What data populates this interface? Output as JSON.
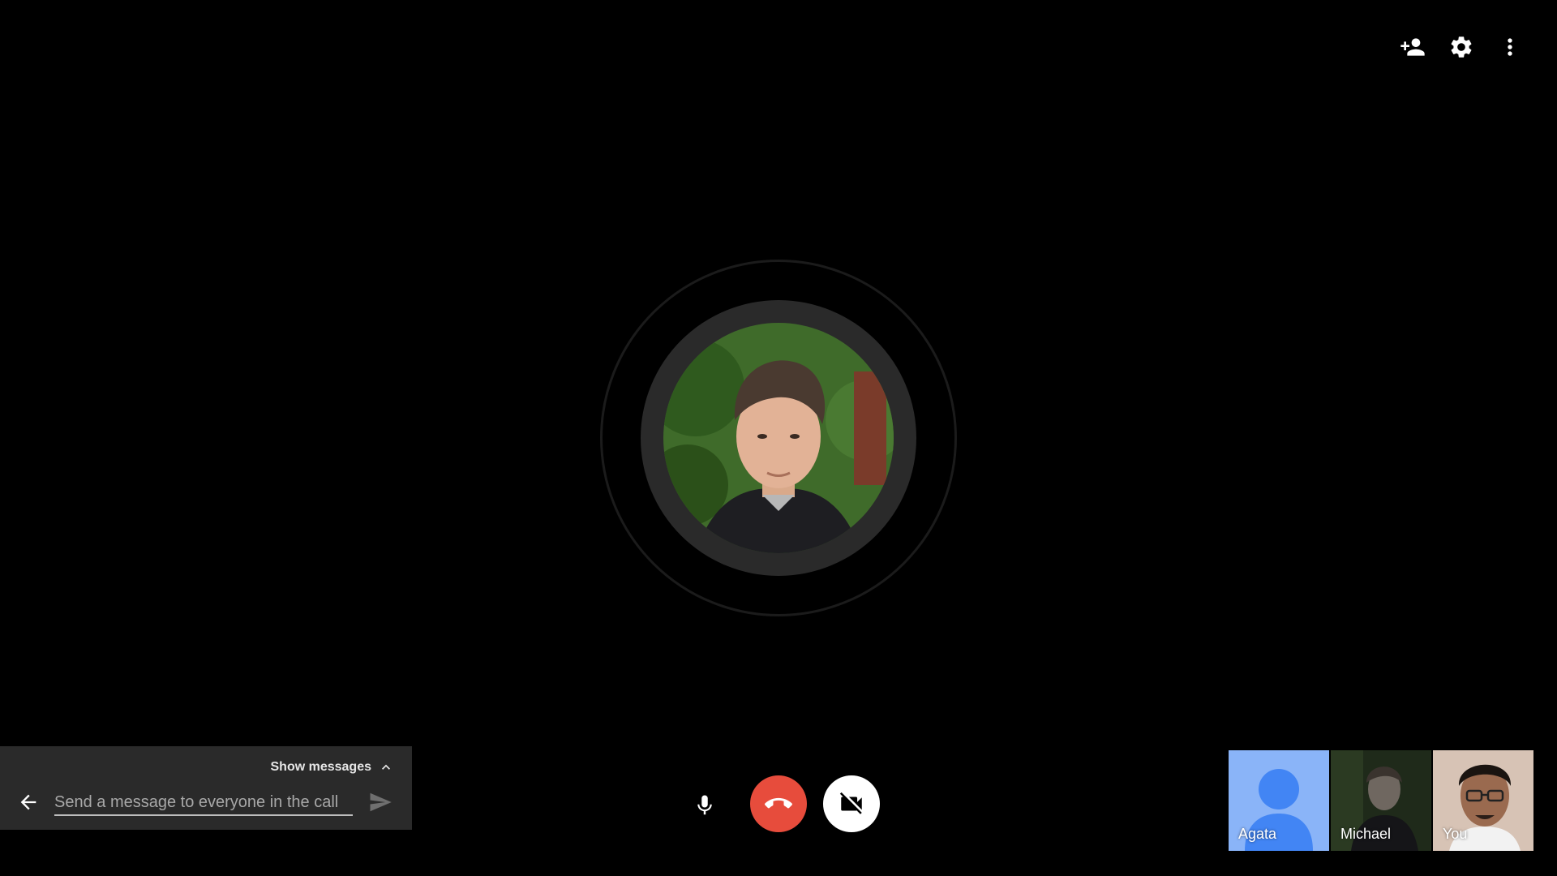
{
  "top_actions": {
    "icons": [
      "add-person-icon",
      "settings-icon",
      "more-vert-icon"
    ]
  },
  "chat": {
    "show_messages_label": "Show messages",
    "input_placeholder": "Send a message to everyone in the call",
    "icons": [
      "back-arrow-icon",
      "chevron-up-icon",
      "send-icon"
    ]
  },
  "controls": {
    "icons": [
      "microphone-icon",
      "hangup-icon",
      "camera-off-icon"
    ],
    "colors": {
      "hangup": "#e74c3c",
      "camera_bg": "#ffffff"
    }
  },
  "participants": [
    {
      "name": "Agata",
      "tile_color": "#8ab4f8",
      "avatar_color": "#4285f4"
    },
    {
      "name": "Michael"
    },
    {
      "name": "You"
    }
  ]
}
